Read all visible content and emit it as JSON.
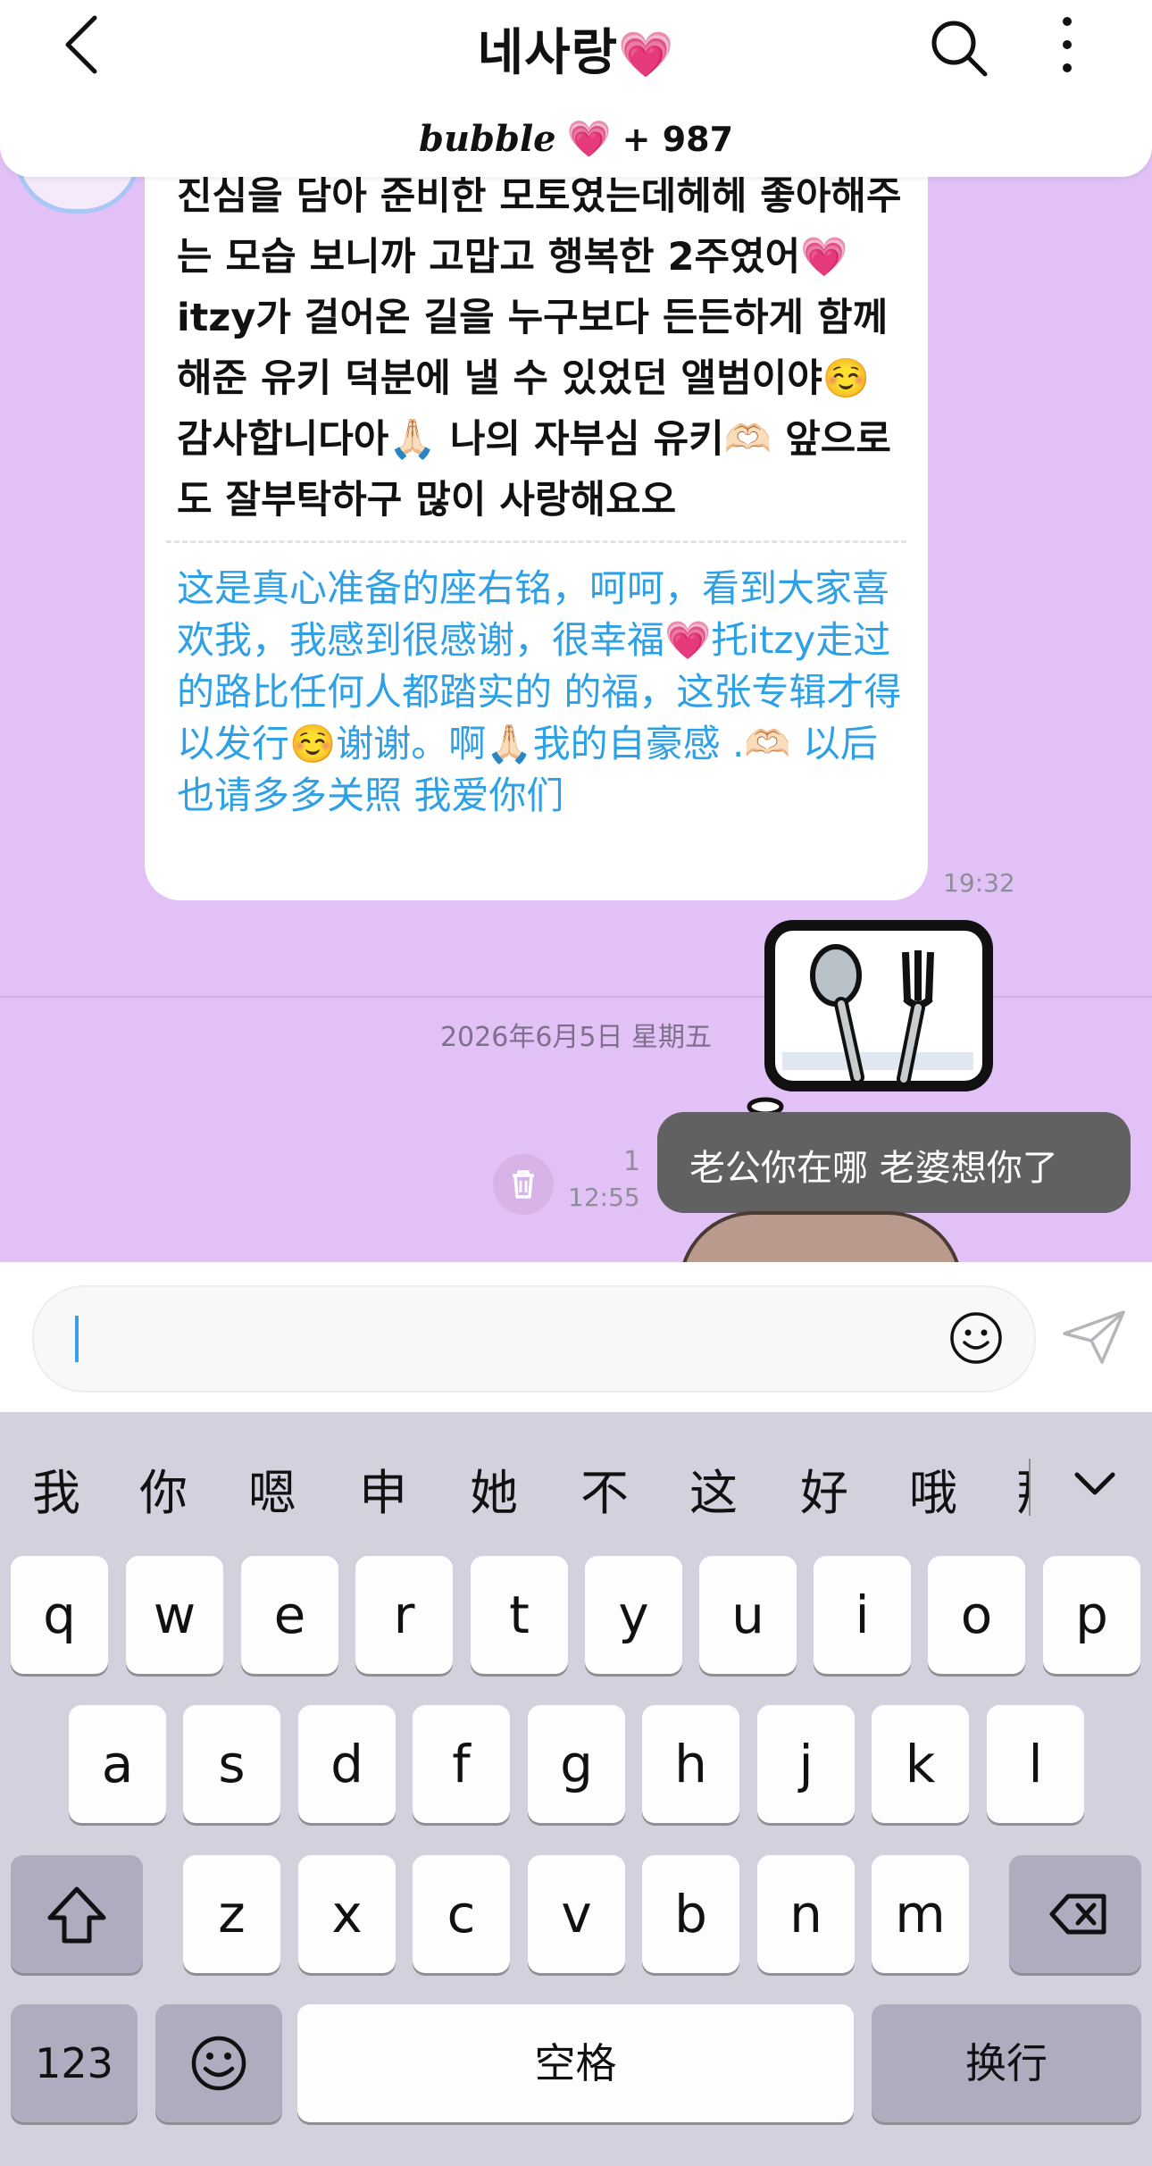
{
  "header": {
    "title": "네사랑",
    "title_heart": "💗",
    "bubble_logo": "bubble",
    "bubble_heart": "💗",
    "bubble_count": "+ 987"
  },
  "message": {
    "korean_text": "진심을 담아 준비한 모토였는데헤헤 좋아해주는 모습 보니까 고맙고 행복한 2주였어💗 itzy가 걸어온 길을 누구보다 든든하게 함께해준 유키 덕분에 낼 수 있었던 앨범이야☺️ 감사합니다아🙏🏻 나의 자부심 유키🫶🏻 앞으로도 잘부탁하구 많이 사랑해요오",
    "chinese_text": "这是真心准备的座右铭，呵呵，看到大家喜欢我，我感到很感谢，很幸福💗托itzy走过的路比任何人都踏实的 的福，这张专辑才得以发行☺️谢谢。啊🙏🏻我的自豪感 .🫶🏻 以后也请多多关照 我爱你们",
    "time": "19:32"
  },
  "date_divider": "2026年6月5日 星期五",
  "my_message": {
    "text": "老公你在哪 老婆想你了",
    "unread_count": "1",
    "time": "12:55"
  },
  "input": {
    "value": "",
    "placeholder": ""
  },
  "keyboard": {
    "candidates": [
      "我",
      "你",
      "嗯",
      "申",
      "她",
      "不",
      "这",
      "好",
      "哦",
      "那"
    ],
    "row1": [
      "q",
      "w",
      "e",
      "r",
      "t",
      "y",
      "u",
      "i",
      "o",
      "p"
    ],
    "row2": [
      "a",
      "s",
      "d",
      "f",
      "g",
      "h",
      "j",
      "k",
      "l"
    ],
    "row3": [
      "z",
      "x",
      "c",
      "v",
      "b",
      "n",
      "m"
    ],
    "numbers_label": "123",
    "space_label": "空格",
    "return_label": "换行"
  },
  "colors": {
    "chat_background": "#e2c2f6",
    "my_bubble": "#616161",
    "translation_text": "#2ea0e6",
    "keyboard_background": "#d3d1dd",
    "accent_pink": "#f056b8"
  },
  "icons": [
    "back-arrow-icon",
    "search-icon",
    "more-vertical-icon",
    "trash-icon",
    "smiley-icon",
    "send-plane-icon",
    "chevron-down-icon",
    "shift-icon",
    "backspace-icon",
    "emoji-key-icon"
  ]
}
